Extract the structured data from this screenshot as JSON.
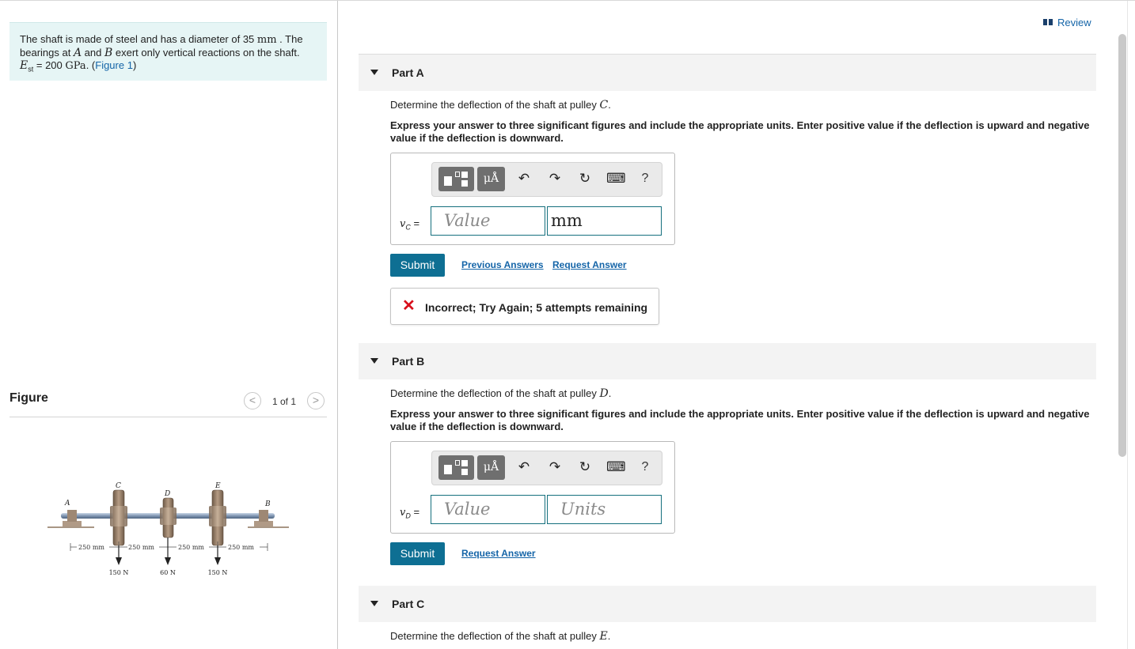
{
  "problem": {
    "line1_pre": "The shaft is made of steel and has a diameter of 35 ",
    "line1_unit": "mm",
    "line1_post": " . The",
    "line2_pre": "bearings at ",
    "point_a": "A",
    "line2_mid": " and ",
    "point_b": "B",
    "line2_post": " exert only vertical reactions on the shaft.",
    "e_symbol": "E",
    "e_sub": "st",
    "e_eq": " = 200 ",
    "e_unit": "GPa",
    "e_post": ". (",
    "figure_link": "Figure 1",
    "e_close": ")"
  },
  "figure_panel": {
    "title": "Figure",
    "pager_text": "1 of 1",
    "prev_glyph": "<",
    "next_glyph": ">",
    "labels": {
      "a": "A",
      "b": "B",
      "c": "C",
      "d": "D",
      "e": "E"
    },
    "dims": [
      "250 mm",
      "250 mm",
      "250 mm",
      "250 mm"
    ],
    "loads": [
      "150 N",
      "60 N",
      "150 N"
    ]
  },
  "review_label": "Review",
  "toolbar": {
    "units_glyph": "μÅ",
    "undo_glyph": "↶",
    "redo_glyph": "↷",
    "reset_glyph": "↻",
    "keyboard_glyph": "⌨",
    "help_glyph": "?"
  },
  "parts": [
    {
      "title": "Part A",
      "question_pre": "Determine the deflection of the shaft at pulley ",
      "question_var": "C",
      "question_post": ".",
      "instructions": "Express your answer to three significant figures and include the appropriate units. Enter positive value if the deflection is upward and negative value if the deflection is downward.",
      "var": "v",
      "var_sub": "C",
      "eq": " =",
      "value_placeholder": "Value",
      "units_value": "mm",
      "submit": "Submit",
      "previous_answers": "Previous Answers",
      "request_answer": "Request Answer",
      "feedback_icon": "✕",
      "feedback": "Incorrect; Try Again; 5 attempts remaining"
    },
    {
      "title": "Part B",
      "question_pre": "Determine the deflection of the shaft at pulley ",
      "question_var": "D",
      "question_post": ".",
      "instructions": "Express your answer to three significant figures and include the appropriate units. Enter positive value if the deflection is upward and negative value if the deflection is downward.",
      "var": "v",
      "var_sub": "D",
      "eq": " =",
      "value_placeholder": "Value",
      "units_placeholder": "Units",
      "submit": "Submit",
      "request_answer": "Request Answer"
    },
    {
      "title": "Part C",
      "question_pre": "Determine the deflection of the shaft at pulley ",
      "question_var": "E",
      "question_post": "."
    }
  ]
}
